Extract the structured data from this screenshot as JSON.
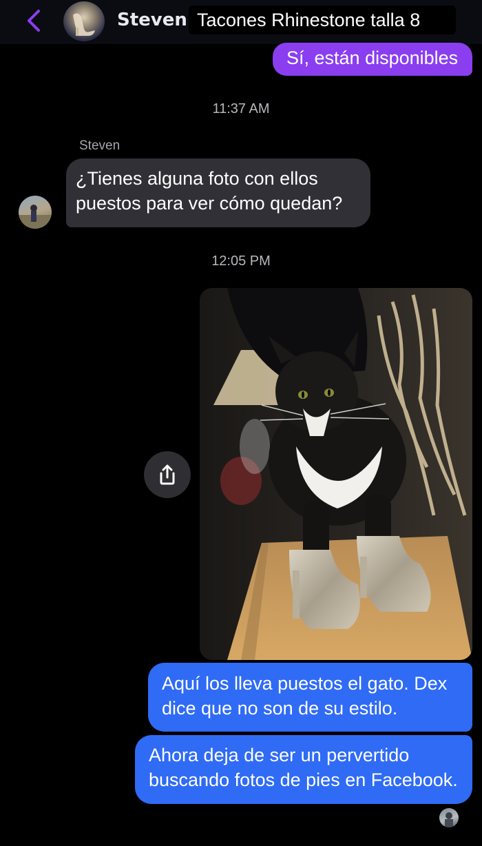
{
  "header": {
    "contact_name": "Steven",
    "banner_title": "Tacones Rhinestone talla 8",
    "back_icon": "chevron-left-icon",
    "accent_color": "#8a3ef0"
  },
  "messages": {
    "outgoing_top": "Sí, están disponibles",
    "timestamp_1": "11:37 AM",
    "sender_label": "Steven",
    "incoming_question": "¿Tienes alguna foto con ellos puestos para ver cómo quedan?",
    "timestamp_2": "12:05 PM",
    "photo_icon": "share-icon",
    "reply_1": "Aquí los lleva puestos el gato. Dex dice que no son de su estilo.",
    "reply_2": "Ahora deja de ser un pervertido buscando fotos de pies en Facebook.",
    "bubble_colors": {
      "outgoing_purple": "#8a3ef0",
      "incoming_gray": "#303036",
      "outgoing_blue": "#2f6bf5"
    }
  }
}
